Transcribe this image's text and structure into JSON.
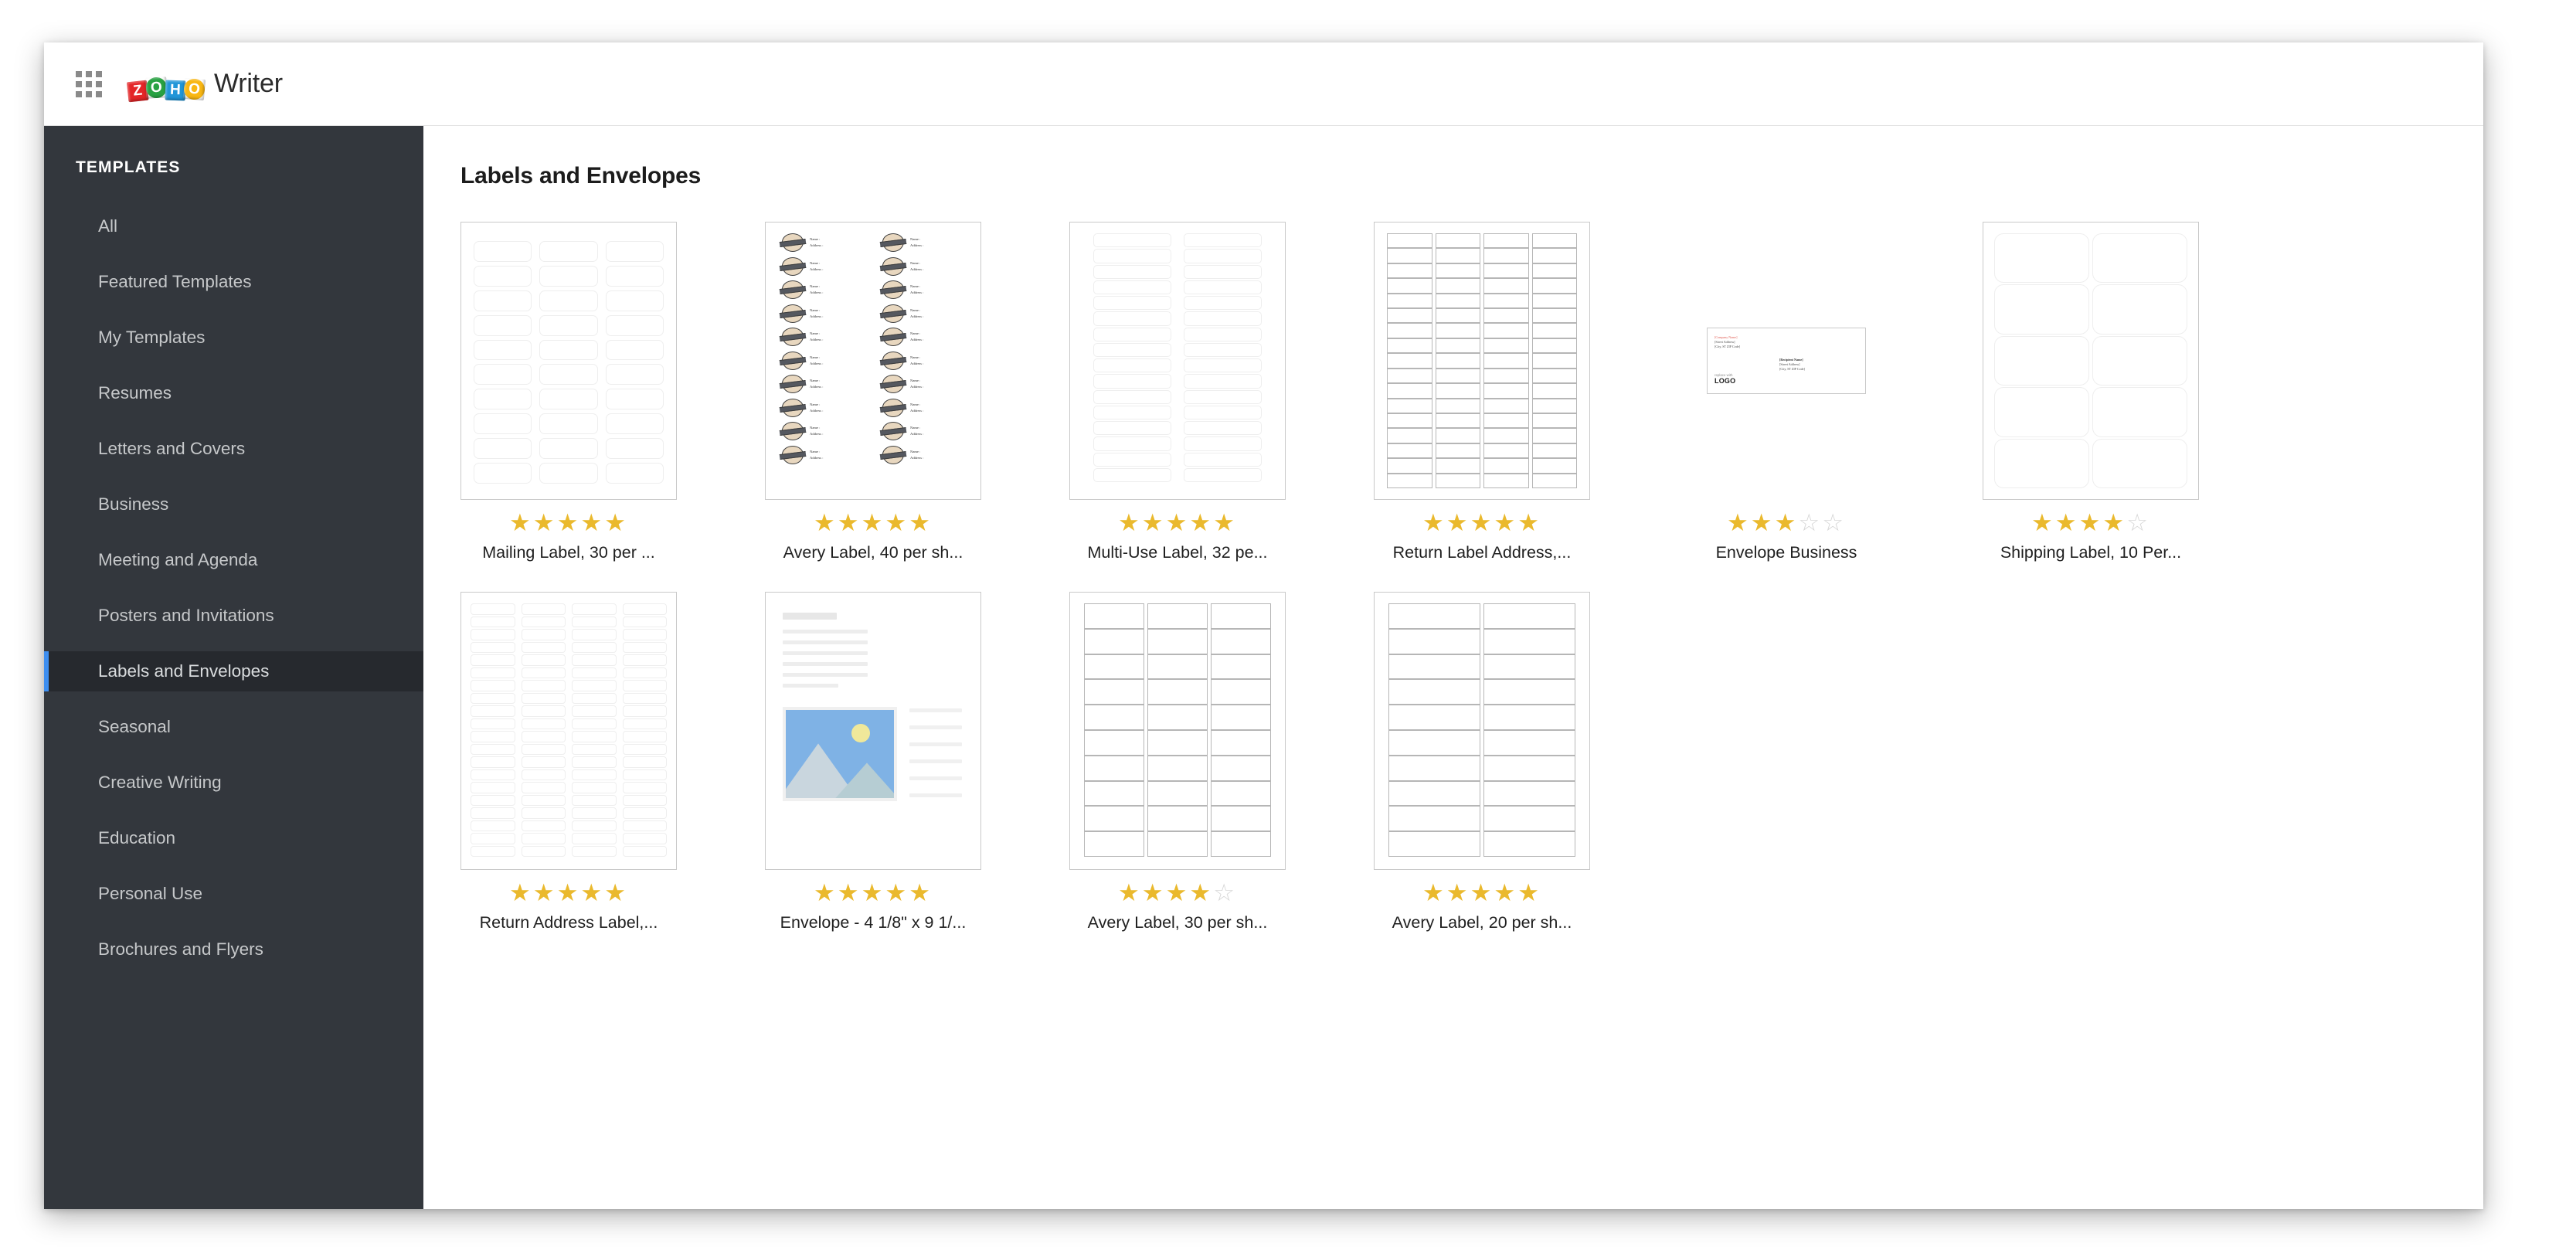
{
  "header": {
    "app_launcher_icon": "grid-apps-icon",
    "logo_letters": [
      "Z",
      "O",
      "H",
      "O"
    ],
    "logo_colors": [
      "#e42527",
      "#29a243",
      "#2196d8",
      "#f9b713"
    ],
    "app_title": "Writer"
  },
  "sidebar": {
    "heading": "TEMPLATES",
    "accent_color": "#3d8ef0",
    "background_color": "#33373d",
    "items": [
      {
        "label": "All",
        "active": false
      },
      {
        "label": "Featured Templates",
        "active": false
      },
      {
        "label": "My Templates",
        "active": false
      },
      {
        "label": "Resumes",
        "active": false
      },
      {
        "label": "Letters and Covers",
        "active": false
      },
      {
        "label": "Business",
        "active": false
      },
      {
        "label": "Meeting and Agenda",
        "active": false
      },
      {
        "label": "Posters and Invitations",
        "active": false
      },
      {
        "label": "Labels and Envelopes",
        "active": true
      },
      {
        "label": "Seasonal",
        "active": false
      },
      {
        "label": "Creative Writing",
        "active": false
      },
      {
        "label": "Education",
        "active": false
      },
      {
        "label": "Personal Use",
        "active": false
      },
      {
        "label": "Brochures and Flyers",
        "active": false
      }
    ]
  },
  "main": {
    "page_title": "Labels and Envelopes",
    "star_filled_color": "#eab92d",
    "star_empty_color": "#d6d6d6",
    "templates": [
      {
        "title": "Mailing Label, 30 per ...",
        "rating": 5,
        "max_rating": 5,
        "thumb": "grid-soft-3x10"
      },
      {
        "title": "Avery Label, 40 per sh...",
        "rating": 5,
        "max_rating": 5,
        "thumb": "avery-decorative-2x10"
      },
      {
        "title": "Multi-Use Label, 32 pe...",
        "rating": 5,
        "max_rating": 5,
        "thumb": "grid-soft-2x16"
      },
      {
        "title": "Return Label Address,...",
        "rating": 5,
        "max_rating": 5,
        "thumb": "grid-mid-4x17"
      },
      {
        "title": "Envelope Business",
        "rating": 3,
        "max_rating": 5,
        "thumb": "envelope-business"
      },
      {
        "title": "Shipping Label, 10 Per...",
        "rating": 4,
        "max_rating": 5,
        "thumb": "grid-soft-2x5"
      },
      {
        "title": "Return Address Label,...",
        "rating": 5,
        "max_rating": 5,
        "thumb": "grid-soft-4x20"
      },
      {
        "title": "Envelope - 4 1/8\" x 9 1/...",
        "rating": 5,
        "max_rating": 5,
        "thumb": "document-with-image"
      },
      {
        "title": "Avery Label, 30 per sh...",
        "rating": 4,
        "max_rating": 5,
        "thumb": "grid-line-3x10"
      },
      {
        "title": "Avery Label, 20 per sh...",
        "rating": 5,
        "max_rating": 5,
        "thumb": "grid-line-2x10"
      }
    ]
  },
  "envelope_preview": {
    "sender": [
      "[Company Name]",
      "[Street Address]",
      "[City, ST  ZIP Code]"
    ],
    "recipient": [
      "[Recipient Name]",
      "[Street Address]",
      "[City, ST  ZIP Code]"
    ],
    "logo_caption": "replace with",
    "logo_text": "LOGO",
    "company_name_color": "#e05b52"
  },
  "avery_label_preview": {
    "name_label": "Name :",
    "address_label": "Address :"
  }
}
